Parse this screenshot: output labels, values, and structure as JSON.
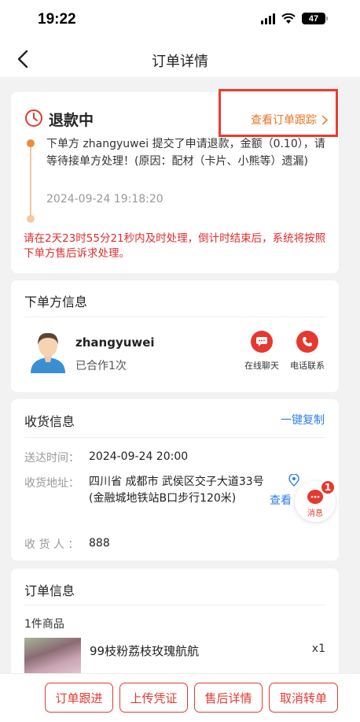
{
  "status_bar": {
    "time": "19:22",
    "battery": "47"
  },
  "nav": {
    "title": "订单详情"
  },
  "refund": {
    "status": "退款中",
    "track_link": "查看订单跟踪",
    "log_text": "下单方 zhangyuwei 提交了申请退款，金额（0.10），请等待接单方处理！(原因：配材（卡片、小熊等）遗漏)",
    "log_time": "2024-09-24 19:18:20",
    "warning": "请在2天23时55分21秒内及时处理，倒计时结束后，系统将按照下单方售后诉求处理。"
  },
  "buyer": {
    "section_title": "下单方信息",
    "name": "zhangyuwei",
    "coop": "已合作1次",
    "chat_label": "在线聊天",
    "call_label": "电话联系"
  },
  "delivery": {
    "section_title": "收货信息",
    "copy_label": "一键复制",
    "time_label": "送达时间：",
    "time_value": "2024-09-24 20:00",
    "addr_label": "收货地址：",
    "addr_value": "四川省 成都市 武侯区交子大道33号(金融城地铁站B口步行120米)",
    "view_label": "查看",
    "receiver_label": "收 货 人 ：",
    "receiver_value": "888"
  },
  "message_float": {
    "label": "消息",
    "badge": "1"
  },
  "order": {
    "section_title": "订单信息",
    "item_count": "1件商品",
    "product_name": "99枝粉荔枝玫瑰航航",
    "product_qty": "x1"
  },
  "bottom_actions": [
    "订单跟进",
    "上传凭证",
    "售后详情",
    "取消转单"
  ],
  "colors": {
    "accent_red": "#e5392f",
    "link_orange": "#e8742a",
    "link_blue": "#2d7ef0"
  }
}
